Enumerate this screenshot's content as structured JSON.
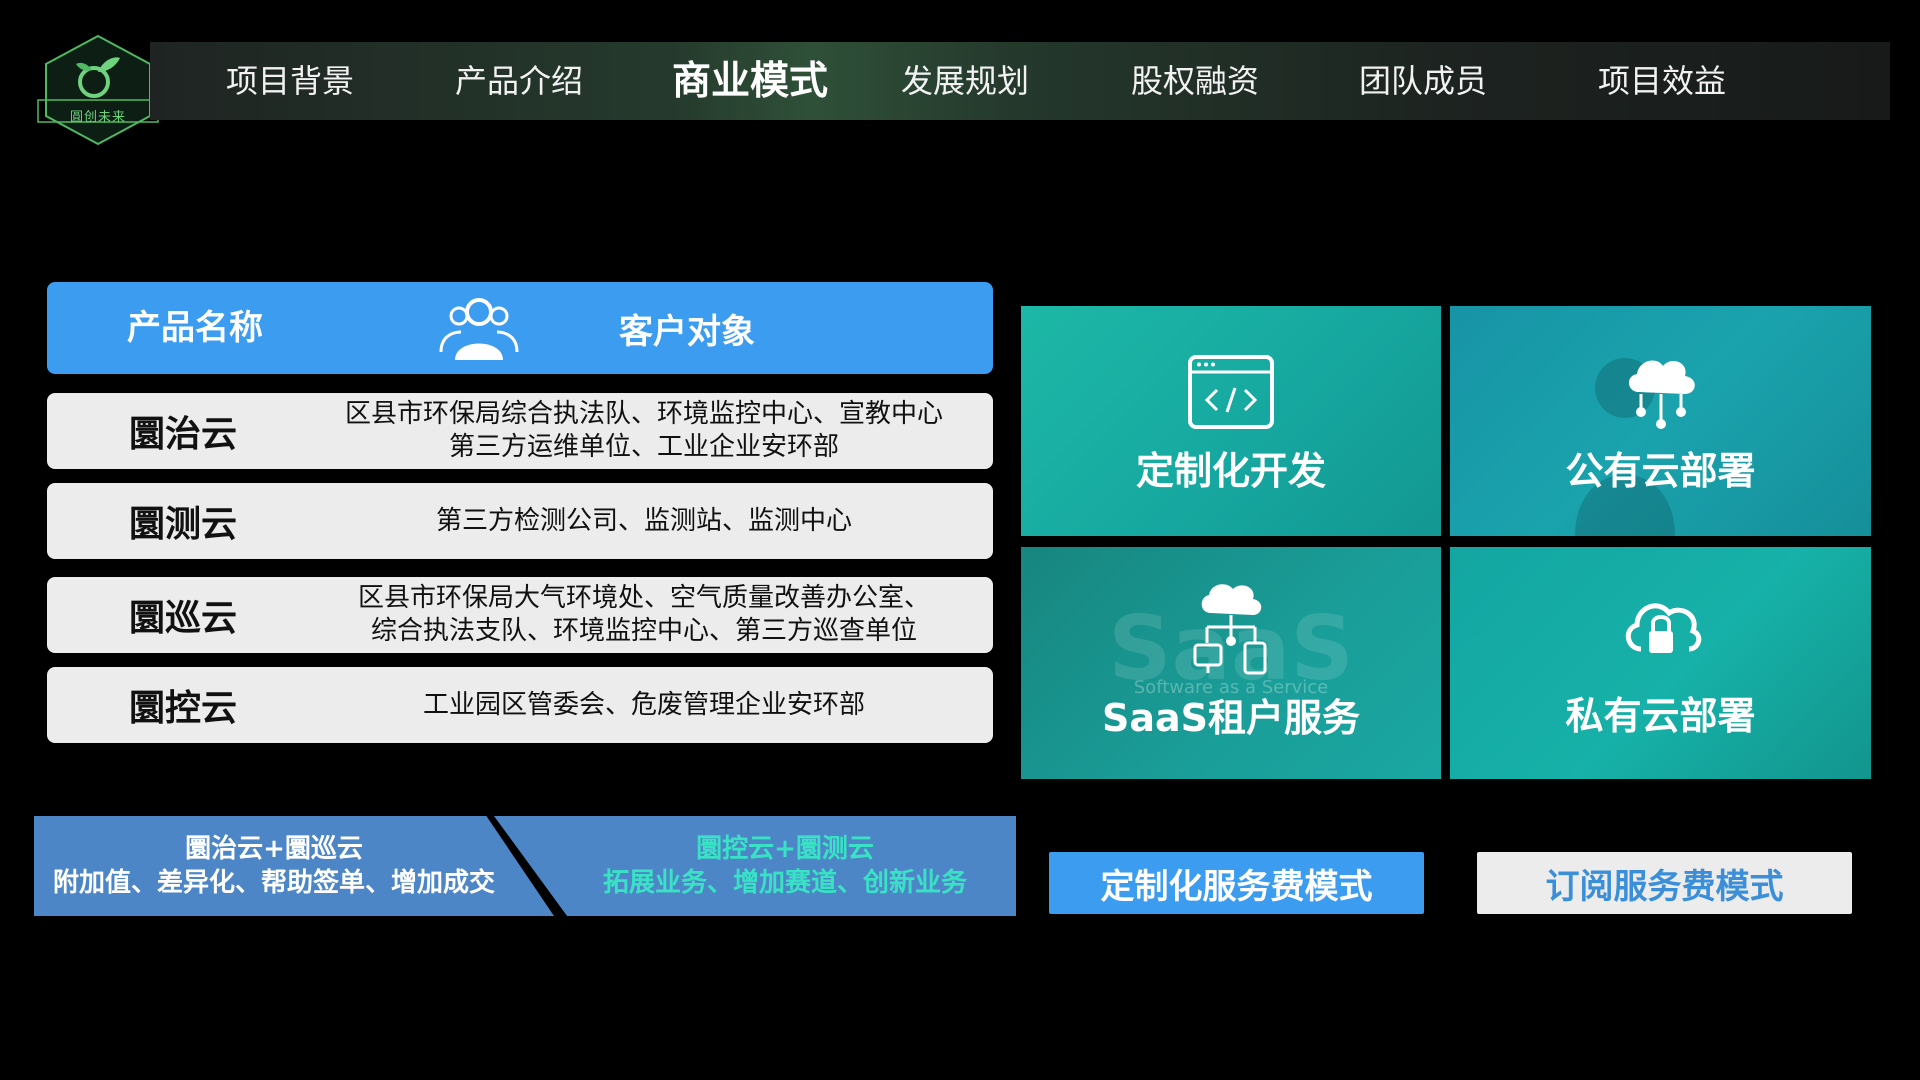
{
  "brand": {
    "logo_text": "圓创未来"
  },
  "nav": {
    "items": [
      "项目背景",
      "产品介绍",
      "商业模式",
      "发展规划",
      "股权融资",
      "团队成员",
      "项目效益"
    ],
    "active": "商业模式"
  },
  "table": {
    "header_product": "产品名称",
    "header_client": "客户对象",
    "rows": [
      {
        "name": "圜治云",
        "desc": [
          "区县市环保局综合执法队、环境监控中心、宣教中心",
          "第三方运维单位、工业企业安环部"
        ]
      },
      {
        "name": "圜测云",
        "desc": [
          "第三方检测公司、监测站、监测中心"
        ]
      },
      {
        "name": "圜巡云",
        "desc": [
          "区县市环保局大气环境处、空气质量改善办公室、",
          "综合执法支队、环境监控中心、第三方巡查单位"
        ]
      },
      {
        "name": "圜控云",
        "desc": [
          "工业园区管委会、危废管理企业安环部"
        ]
      }
    ]
  },
  "banners": {
    "left": {
      "line1": "圜治云+圜巡云",
      "line2": "附加值、差异化、帮助签单、增加成交"
    },
    "right": {
      "line1": "圜控云+圜测云",
      "line2": "拓展业务、增加赛道、创新业务"
    }
  },
  "tiles": {
    "custom_dev": "定制化开发",
    "public_cloud": "公有云部署",
    "saas": "SaaS租户服务",
    "saas_bg": "SaaS",
    "saas_bg_sub": "Software as a Service",
    "private_cloud": "私有云部署"
  },
  "fees": {
    "custom": "定制化服务费模式",
    "subscription": "订阅服务费模式"
  },
  "colors": {
    "accent_blue": "#3b9cf0",
    "banner_blue": "#4d86c6",
    "teal_text": "#39e2c5",
    "row_bg": "#ececec"
  },
  "icons": [
    "logo-emblem",
    "users-icon",
    "code-window-icon",
    "cloud-network-icon",
    "saas-cloud-devices-icon",
    "cloud-lock-icon"
  ]
}
